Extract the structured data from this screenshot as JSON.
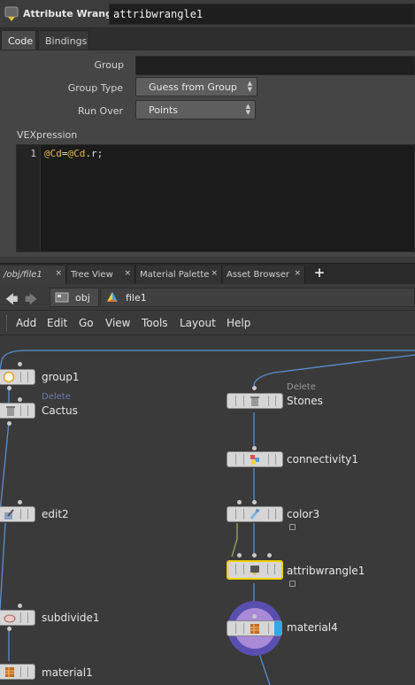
{
  "param_pane": {
    "node_type_label": "Attribute Wrangle",
    "node_name": "attribwrangle1",
    "tabs": [
      {
        "label": "Code"
      },
      {
        "label": "Bindings"
      }
    ],
    "group_label": "Group",
    "group_value": "",
    "group_type_label": "Group Type",
    "group_type_value": "Guess from Group",
    "run_over_label": "Run Over",
    "run_over_value": "Points",
    "vexpression_label": "VEXpression",
    "code": {
      "line_number": "1",
      "tok1": "@Cd",
      "tok2": "=",
      "tok3": "@Cd",
      "tok4": ".r;"
    }
  },
  "network_tabs": [
    {
      "label": "/obj/file1"
    },
    {
      "label": "Tree View"
    },
    {
      "label": "Material Palette"
    },
    {
      "label": "Asset Browser"
    }
  ],
  "tab_close": "×",
  "tab_add": "+",
  "path": {
    "back": "🡄",
    "forward": "🡆",
    "obj": "obj",
    "file": "file1"
  },
  "menu": [
    "Add",
    "Edit",
    "Go",
    "View",
    "Tools",
    "Layout",
    "Help"
  ],
  "nodes": {
    "group1": "group1",
    "cactus": "Cactus",
    "cactus_overlay": "Delete",
    "edit2": "edit2",
    "subdivide1": "subdivide1",
    "material1": "material1",
    "stones": "Stones",
    "stones_note": "Delete",
    "connectivity1": "connectivity1",
    "color3": "color3",
    "attribwrangle1": "attribwrangle1",
    "material4": "material4"
  },
  "colors": {
    "selected_outline": "#f0d000",
    "material_bubble": "#6a5fc0",
    "wire": "#5a8fd0"
  }
}
